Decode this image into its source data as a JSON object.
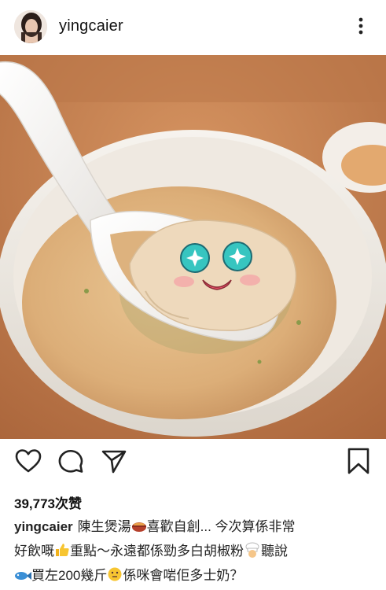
{
  "header": {
    "username": "yingcaier"
  },
  "post": {
    "likes": "39,773次赞",
    "caption_user": "yingcaier",
    "caption_line1": "陳生煲湯",
    "caption_line1b": "喜歡自創... 今次算係非常",
    "caption_line2a": "好飲嘅",
    "caption_line2b": "重點～永遠都係勁多白胡椒粉",
    "caption_line2c": "聽說",
    "caption_line3a": "買左200幾斤",
    "caption_line3b": "係咪會啱佢多士奶？"
  },
  "icons": {
    "avatar": "avatar",
    "more": "more-vertical-icon",
    "like": "heart-icon",
    "comment": "comment-icon",
    "share": "send-icon",
    "bookmark": "bookmark-icon"
  },
  "colors": {
    "text": "#111111",
    "soup": "#e0b883",
    "bowl": "#f2efea",
    "table": "#c47d4e"
  }
}
